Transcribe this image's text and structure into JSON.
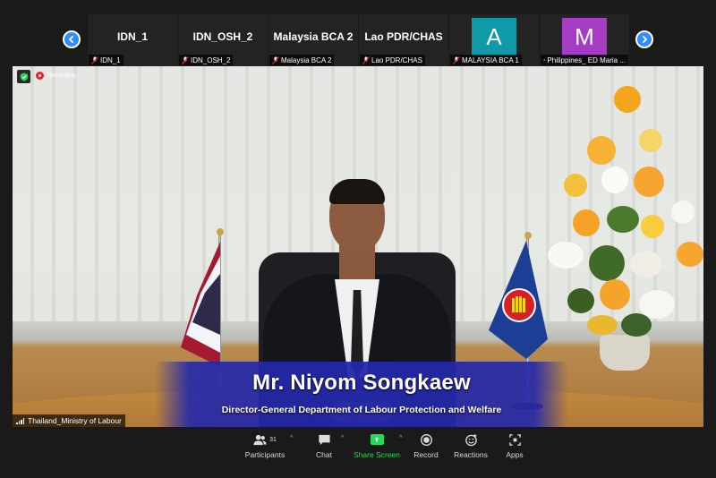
{
  "participants_strip": {
    "tiles": [
      {
        "title": "IDN_1",
        "footer": "IDN_1"
      },
      {
        "title": "IDN_OSH_2",
        "footer": "IDN_OSH_2"
      },
      {
        "title": "Malaysia BCA 2",
        "footer": "Malaysia BCA 2"
      },
      {
        "title": "Lao PDR/CHAS",
        "footer": "Lao PDR/CHAS"
      },
      {
        "avatar_letter": "A",
        "avatar_color": "#0e9aa7",
        "footer": "MALAYSIA BCA 1"
      },
      {
        "avatar_letter": "M",
        "avatar_color": "#a43cc4",
        "footer": "Philippines_ ED Maria ..."
      }
    ]
  },
  "video": {
    "recording_label": "Recording",
    "speaker_name_tag": "Thailand_Ministry of Labour",
    "banner": {
      "name": "Mr. Niyom Songkaew",
      "title": "Director-General Department of Labour Protection and Welfare"
    }
  },
  "toolbar": {
    "participants_label": "Participants",
    "participants_count": "31",
    "chat_label": "Chat",
    "share_label": "Share Screen",
    "record_label": "Record",
    "reactions_label": "Reactions",
    "apps_label": "Apps"
  },
  "colors": {
    "accent": "#2d8cff",
    "share": "#23d959",
    "recording": "#e02828",
    "banner": "#2328aa"
  }
}
